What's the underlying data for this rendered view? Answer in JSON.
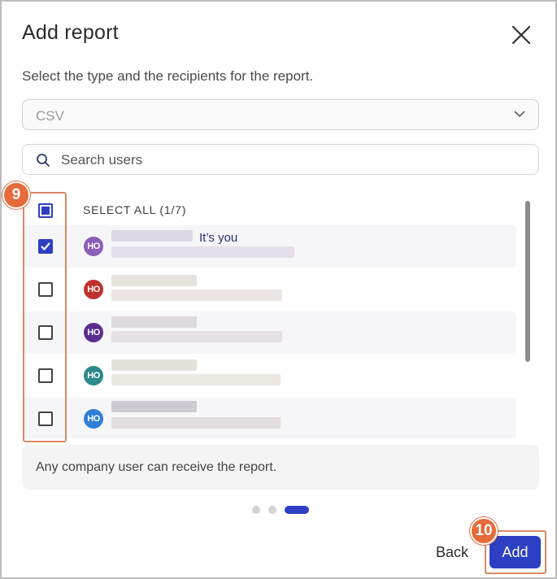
{
  "dialog": {
    "title": "Add report",
    "subtitle": "Select the type and the recipients for the report.",
    "report_type": {
      "value": "CSV"
    },
    "search": {
      "placeholder": "Search users",
      "value": ""
    }
  },
  "recipients": {
    "select_all_label": "SELECT ALL (1/7)",
    "select_all_state": "indeterminate",
    "users": [
      {
        "initials": "HO",
        "avatar_color": "#8a5fb8",
        "checked": true,
        "tag": "It’s you"
      },
      {
        "initials": "HO",
        "avatar_color": "#c0302f",
        "checked": false
      },
      {
        "initials": "HO",
        "avatar_color": "#5b2d8e",
        "checked": false
      },
      {
        "initials": "HO",
        "avatar_color": "#2c8a8a",
        "checked": false
      },
      {
        "initials": "HO",
        "avatar_color": "#2f7fd6",
        "checked": false
      }
    ]
  },
  "info_text": "Any company user can receive the report.",
  "pagination": {
    "steps": 3,
    "current": 3
  },
  "footer": {
    "back_label": "Back",
    "add_label": "Add"
  },
  "annotations": {
    "step_9": "9",
    "step_10": "10"
  },
  "colors": {
    "primary": "#2d3fc2",
    "highlight": "#d98a66",
    "badge": "#e66a3a"
  }
}
